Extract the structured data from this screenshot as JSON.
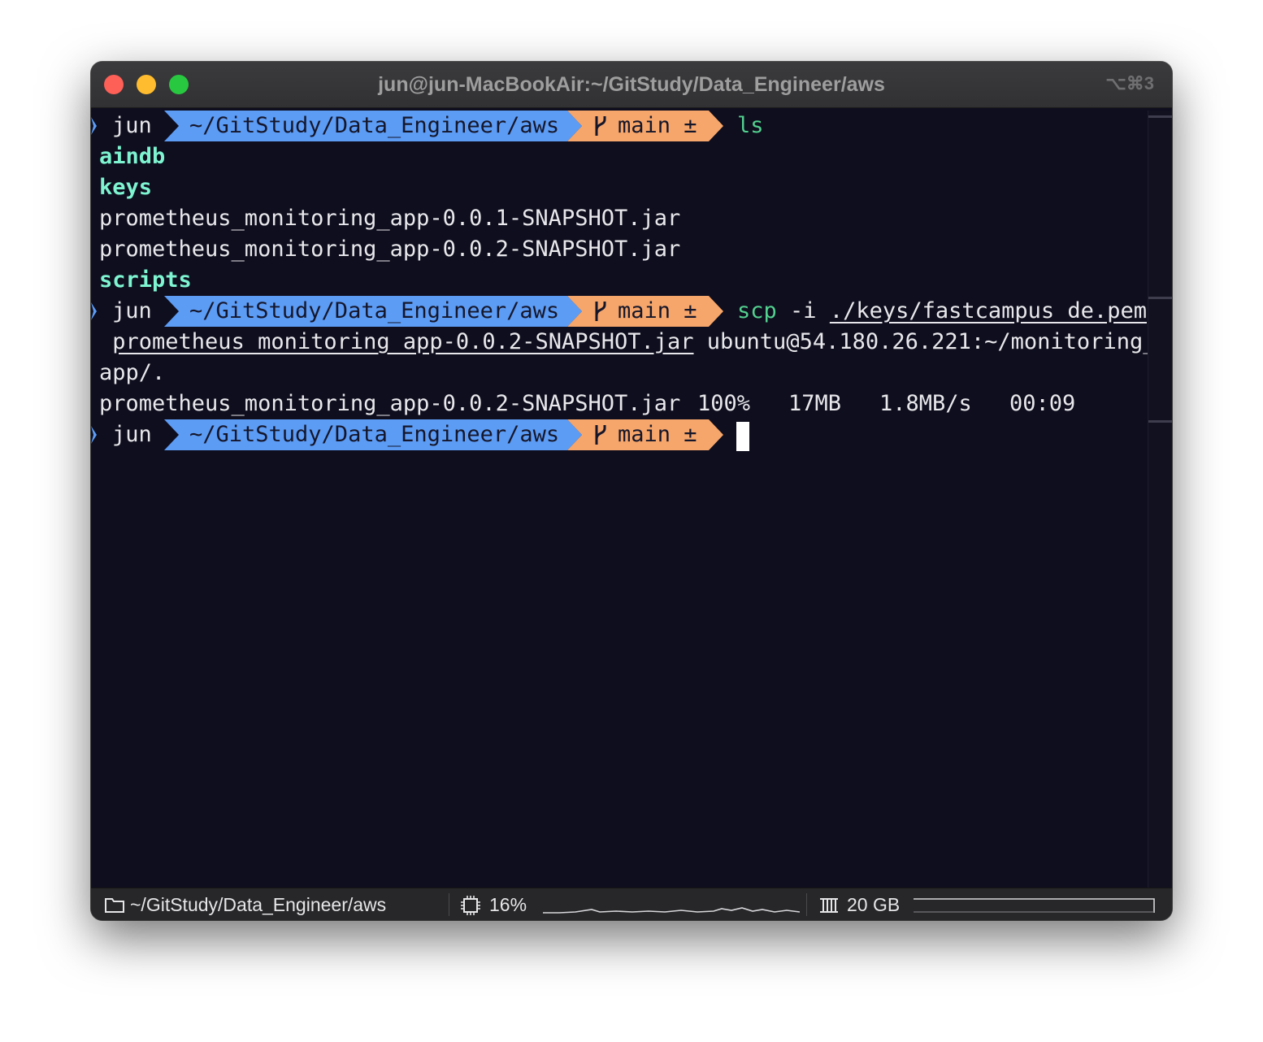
{
  "window": {
    "title": "jun@jun-MacBookAir:~/GitStudy/Data_Engineer/aws",
    "shortcut": "⌥⌘3"
  },
  "prompt": {
    "chevron": "❯",
    "user": "jun",
    "path": "~/GitStudy/Data_Engineer/aws",
    "branch_icon": "branch-icon",
    "branch": "main ±"
  },
  "colors": {
    "background": "#0f0e1e",
    "path_segment": "#5c9cf5",
    "branch_segment": "#f6a66b",
    "command": "#53d18f",
    "directory": "#7ef4d1"
  },
  "terminal": {
    "cmd1": {
      "name": "ls"
    },
    "ls_output": [
      {
        "text": "aindb",
        "type": "dir"
      },
      {
        "text": "keys",
        "type": "dir"
      },
      {
        "text": "prometheus_monitoring_app-0.0.1-SNAPSHOT.jar",
        "type": "file"
      },
      {
        "text": "prometheus_monitoring_app-0.0.2-SNAPSHOT.jar",
        "type": "file"
      },
      {
        "text": "scripts",
        "type": "dir"
      }
    ],
    "cmd2": {
      "name": "scp",
      "flag": "-i",
      "key_path": "./keys/fastcampus_de.pem",
      "source_file": "prometheus_monitoring_app-0.0.2-SNAPSHOT.jar",
      "destination_part1": "ubuntu@54.180.26.221:~/monitoring_",
      "destination_part2": "app/."
    },
    "scp_progress": {
      "file": "prometheus_monitoring_app-0.0.2-SNAPSHOT.jar",
      "percent": "100%",
      "size": "17MB",
      "rate": "1.8MB/s",
      "eta": "00:09"
    }
  },
  "statusbar": {
    "folder_icon": "folder-icon",
    "path": "~/GitStudy/Data_Engineer/aws",
    "cpu_icon": "cpu-icon",
    "cpu_percent": "16%",
    "memory_icon": "memory-icon",
    "memory": "20 GB"
  }
}
